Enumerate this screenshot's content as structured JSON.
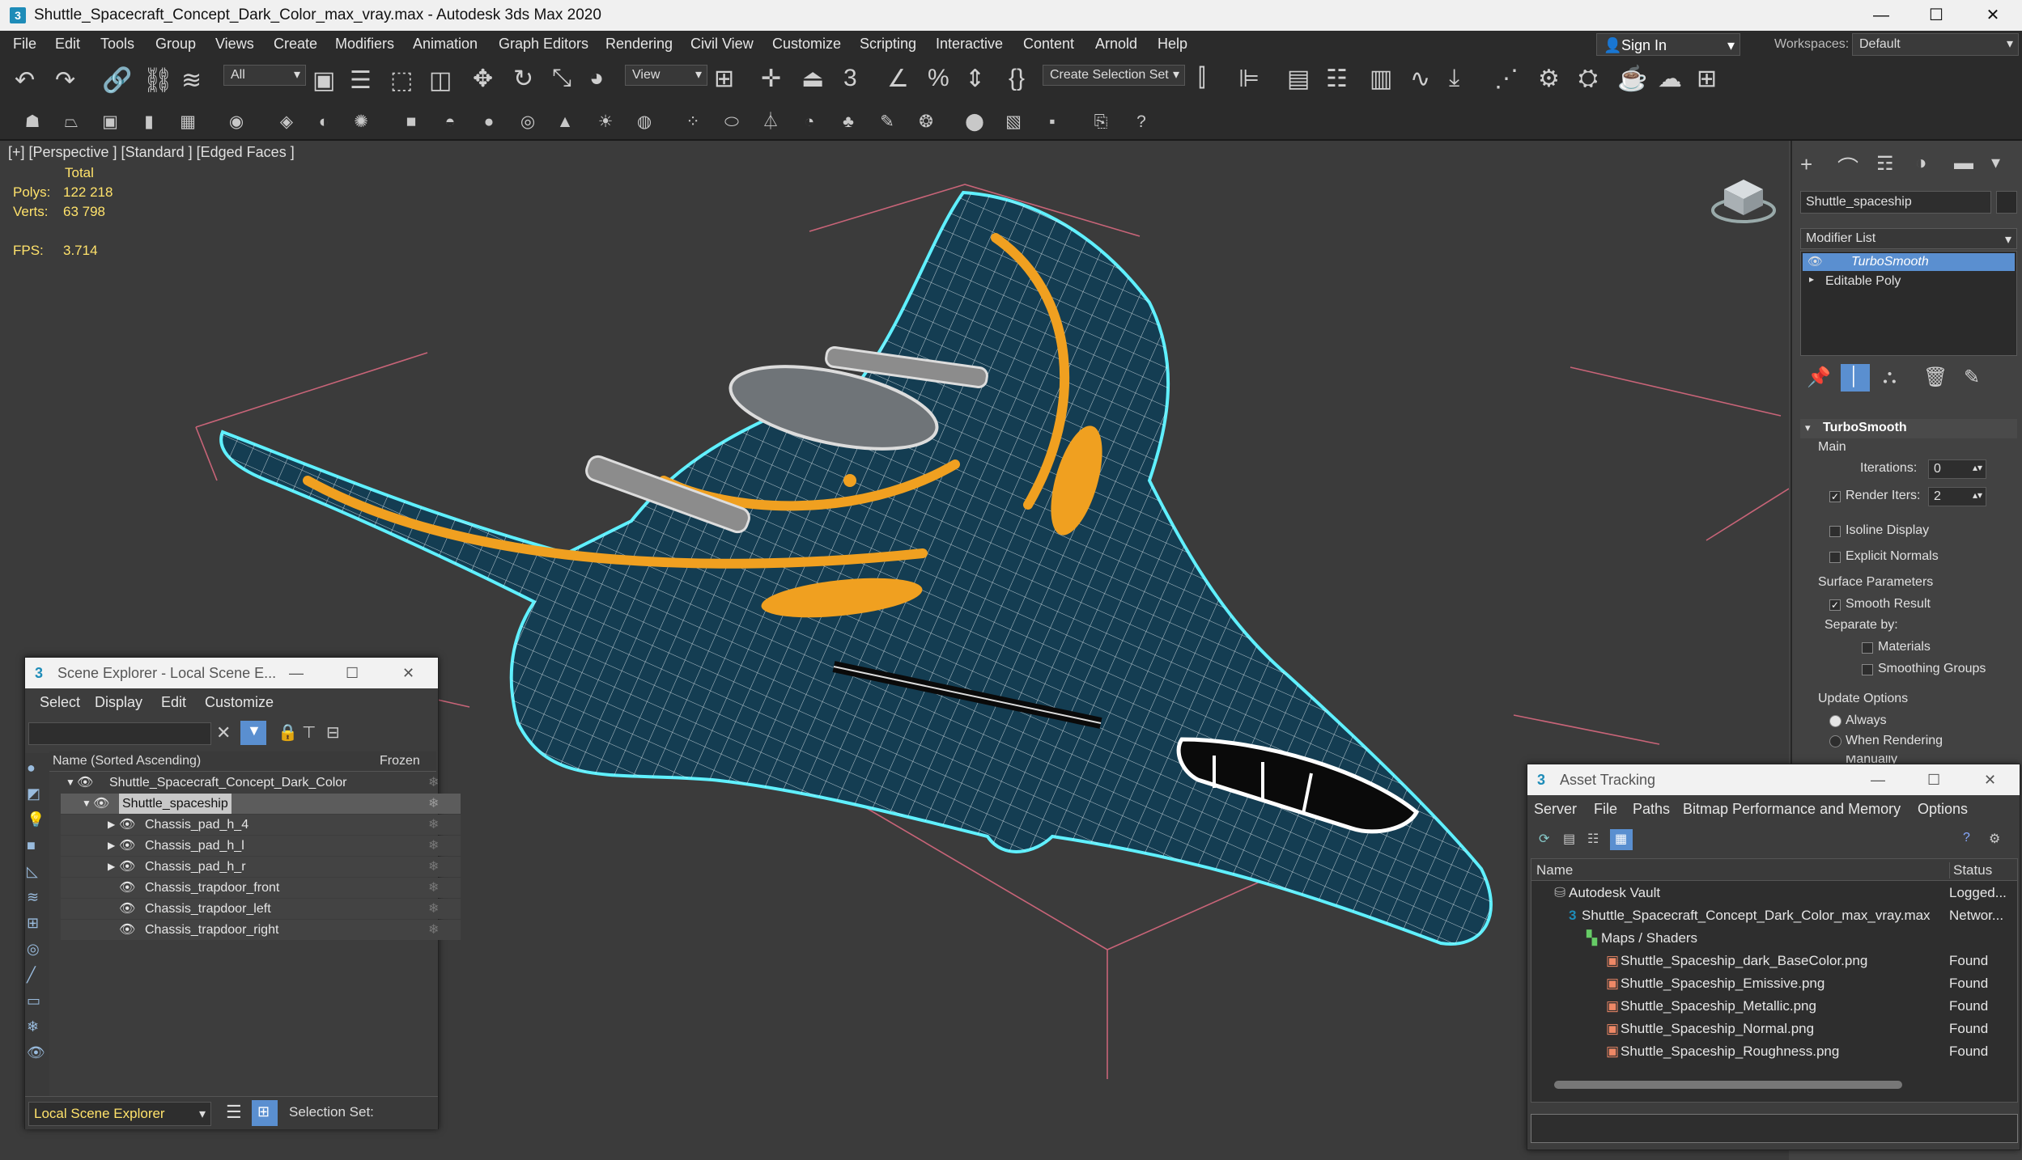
{
  "window": {
    "title": "Shuttle_Spacecraft_Concept_Dark_Color_max_vray.max - Autodesk 3ds Max 2020",
    "minimize": "—",
    "maximize": "☐",
    "close": "✕"
  },
  "menu": {
    "items": [
      "File",
      "Edit",
      "Tools",
      "Group",
      "Views",
      "Create",
      "Modifiers",
      "Animation",
      "Graph Editors",
      "Rendering",
      "Civil View",
      "Customize",
      "Scripting",
      "Interactive",
      "Content",
      "Arnold",
      "Help"
    ],
    "sign_in": "Sign In",
    "workspaces_label": "Workspaces:",
    "workspaces_value": "Default"
  },
  "toolbar": {
    "selection_filter": "All",
    "ref_coord": "View",
    "create_selection_set": "Create Selection Set"
  },
  "viewport": {
    "label": "[+] [Perspective ] [Standard ] [Edged Faces ]",
    "total_label": "Total",
    "polys_label": "Polys:",
    "polys_value": "122 218",
    "verts_label": "Verts:",
    "verts_value": "63 798",
    "fps_label": "FPS:",
    "fps_value": "3.714"
  },
  "command_panel": {
    "object_name": "Shuttle_spaceship",
    "modifier_list": "Modifier List",
    "stack": [
      "TurboSmooth",
      "Editable Poly"
    ],
    "rollout_title": "TurboSmooth",
    "main_label": "Main",
    "iterations_label": "Iterations:",
    "iterations_value": "0",
    "render_iters_label": "Render Iters:",
    "render_iters_value": "2",
    "isoline_label": "Isoline Display",
    "explicit_normals_label": "Explicit Normals",
    "surface_params_label": "Surface Parameters",
    "smooth_result_label": "Smooth Result",
    "separate_by_label": "Separate by:",
    "materials_label": "Materials",
    "smoothing_groups_label": "Smoothing Groups",
    "update_options_label": "Update Options",
    "always_label": "Always",
    "when_rendering_label": "When Rendering",
    "manually_label": "Manually"
  },
  "scene_explorer": {
    "title": "Scene Explorer - Local Scene E...",
    "menu": [
      "Select",
      "Display",
      "Edit",
      "Customize"
    ],
    "col_name": "Name (Sorted Ascending)",
    "col_frozen": "Frozen",
    "rows": [
      {
        "label": "Shuttle_Spacecraft_Concept_Dark_Color",
        "depth": 0
      },
      {
        "label": "Shuttle_spaceship",
        "depth": 1
      },
      {
        "label": "Chassis_pad_h_4",
        "depth": 2
      },
      {
        "label": "Chassis_pad_h_l",
        "depth": 2
      },
      {
        "label": "Chassis_pad_h_r",
        "depth": 2
      },
      {
        "label": "Chassis_trapdoor_front",
        "depth": 2
      },
      {
        "label": "Chassis_trapdoor_left",
        "depth": 2
      },
      {
        "label": "Chassis_trapdoor_right",
        "depth": 2
      }
    ],
    "footer_dropdown": "Local Scene Explorer",
    "selection_set_label": "Selection Set:"
  },
  "asset_tracking": {
    "title": "Asset Tracking",
    "menu": [
      "Server",
      "File",
      "Paths",
      "Bitmap Performance and Memory",
      "Options"
    ],
    "col_name": "Name",
    "col_status": "Status",
    "rows": [
      {
        "name": "Autodesk Vault",
        "status": "Logged..."
      },
      {
        "name": "Shuttle_Spacecraft_Concept_Dark_Color_max_vray.max",
        "status": "Networ..."
      },
      {
        "name": "Maps / Shaders",
        "status": ""
      },
      {
        "name": "Shuttle_Spaceship_dark_BaseColor.png",
        "status": "Found"
      },
      {
        "name": "Shuttle_Spaceship_Emissive.png",
        "status": "Found"
      },
      {
        "name": "Shuttle_Spaceship_Metallic.png",
        "status": "Found"
      },
      {
        "name": "Shuttle_Spaceship_Normal.png",
        "status": "Found"
      },
      {
        "name": "Shuttle_Spaceship_Roughness.png",
        "status": "Found"
      }
    ]
  },
  "colors": {
    "viewport_bg": "#3b3b3b",
    "hull": "#143d52",
    "accent_orange": "#f0a020",
    "selection_outline": "#5ff0ff",
    "stat_yellow": "#ffe26b",
    "highlight_blue": "#5a8fd0"
  }
}
